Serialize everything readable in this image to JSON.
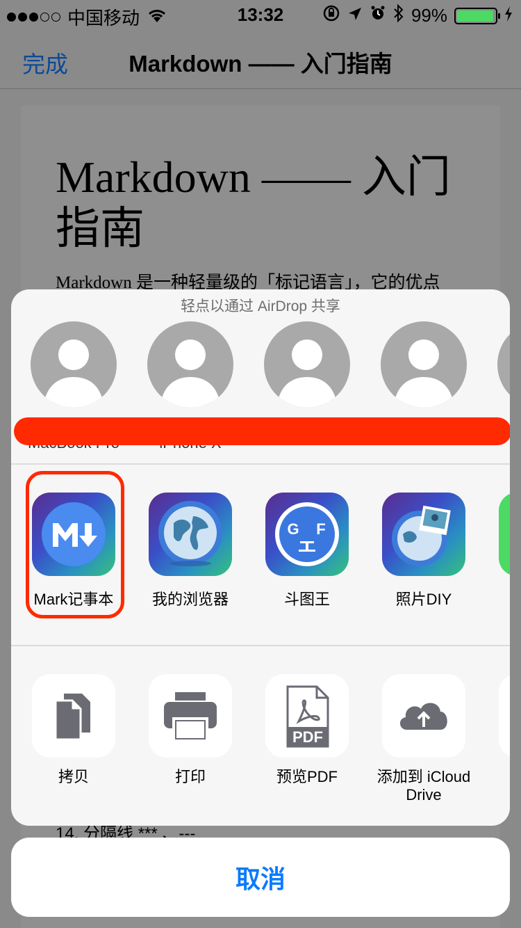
{
  "status_bar": {
    "carrier": "中国移动",
    "time": "13:32",
    "battery": "99%",
    "battery_level": 0.99
  },
  "nav": {
    "done_label": "完成",
    "title": "Markdown —— 入门指南"
  },
  "document": {
    "heading": "Markdown —— 入门指南",
    "paragraph": "Markdown 是一种轻量级的「标记语言」，它的优点",
    "bottom_text": "14. 分隔线 *** 、---"
  },
  "share": {
    "airdrop_hint": "轻点以通过 AirDrop 共享",
    "contacts": [
      {
        "label": "MacBook Pro"
      },
      {
        "label": "iPhone X"
      },
      {
        "label": ""
      },
      {
        "label": ""
      }
    ],
    "apps": [
      {
        "label": "Mark记事本",
        "icon": "markdown-app-icon"
      },
      {
        "label": "我的浏览器",
        "icon": "globe-app-icon"
      },
      {
        "label": "斗图王",
        "icon": "face-app-icon"
      },
      {
        "label": "照片DIY",
        "icon": "photo-globe-app-icon"
      }
    ],
    "actions": [
      {
        "label": "拷贝",
        "icon": "copy-icon"
      },
      {
        "label": "打印",
        "icon": "printer-icon"
      },
      {
        "label": "预览PDF",
        "icon": "pdf-icon"
      },
      {
        "label": "添加到 iCloud Drive",
        "icon": "cloud-upload-icon"
      }
    ],
    "cancel_label": "取消"
  },
  "colors": {
    "accent": "#0a7afe",
    "highlight": "#ff2a00",
    "battery": "#4cd964"
  }
}
